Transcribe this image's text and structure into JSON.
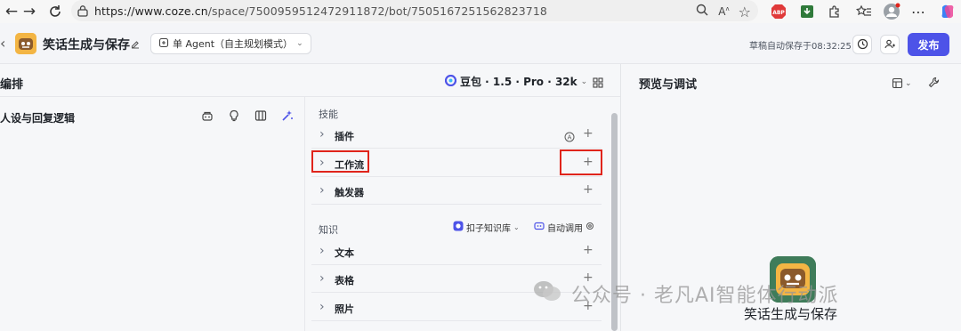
{
  "browser": {
    "url_domain": "https://www.coze.cn",
    "url_path": "/space/7500959512472911872/bot/7505167251562823718"
  },
  "header": {
    "bot_name": "笑话生成与保存",
    "mode_label": "单 Agent（自主规划模式）",
    "autosave": "草稿自动保存于08:32:25",
    "publish_label": "发布"
  },
  "left": {
    "section_title": "编排",
    "model": "豆包 · 1.5 · Pro · 32k",
    "persona_title": "人设与回复逻辑"
  },
  "skills": {
    "title": "技能",
    "items": [
      {
        "label": "插件"
      },
      {
        "label": "工作流"
      },
      {
        "label": "触发器"
      }
    ]
  },
  "knowledge": {
    "title": "知识",
    "kb_label": "扣子知识库",
    "auto_label": "自动调用",
    "items": [
      {
        "label": "文本"
      },
      {
        "label": "表格"
      },
      {
        "label": "照片"
      }
    ]
  },
  "preview": {
    "title": "预览与调试",
    "bot_name": "笑话生成与保存"
  },
  "watermark": {
    "text": "公众号 · 老凡AI智能体行动派"
  },
  "colors": {
    "accent": "#4d53e8",
    "highlight": "#e0241b"
  }
}
